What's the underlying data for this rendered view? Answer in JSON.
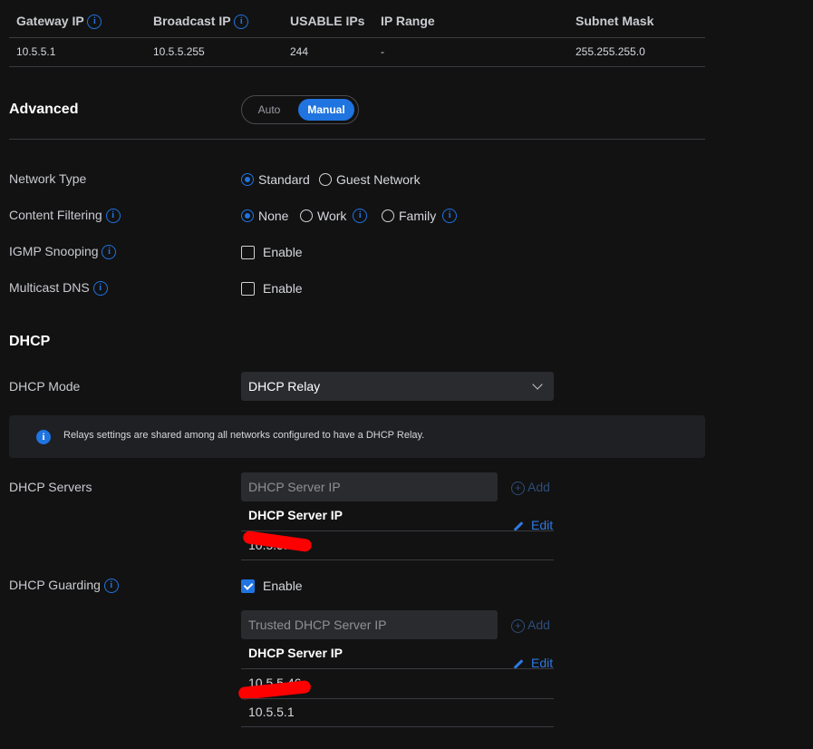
{
  "subnet_table": {
    "headers": [
      "Gateway IP",
      "Broadcast IP",
      "USABLE IPs",
      "IP Range",
      "Subnet Mask"
    ],
    "row": [
      "10.5.5.1",
      "10.5.5.255",
      "244",
      "-",
      "255.255.255.0"
    ]
  },
  "advanced": {
    "title": "Advanced",
    "mode_options": [
      "Auto",
      "Manual"
    ],
    "selected_mode": "Manual"
  },
  "network_type": {
    "label": "Network Type",
    "options": [
      "Standard",
      "Guest Network"
    ],
    "selected": "Standard"
  },
  "content_filtering": {
    "label": "Content Filtering",
    "options": [
      "None",
      "Work",
      "Family"
    ],
    "selected": "None"
  },
  "igmp_snooping": {
    "label": "IGMP Snooping",
    "option": "Enable",
    "checked": false
  },
  "multicast_dns": {
    "label": "Multicast DNS",
    "option": "Enable",
    "checked": false
  },
  "dhcp": {
    "title": "DHCP",
    "mode_label": "DHCP Mode",
    "mode_value": "DHCP Relay",
    "info_banner": "Relays settings are shared among all networks configured to have a DHCP Relay.",
    "servers": {
      "label": "DHCP Servers",
      "input_placeholder": "DHCP Server IP",
      "add_label": "Add",
      "list_header": "DHCP Server IP",
      "edit_label": "Edit",
      "entries": [
        "10.5.5.46"
      ]
    },
    "guarding": {
      "label": "DHCP Guarding",
      "option": "Enable",
      "checked": true,
      "input_placeholder": "Trusted DHCP Server IP",
      "add_label": "Add",
      "list_header": "DHCP Server IP",
      "edit_label": "Edit",
      "entries": [
        "10.5.5.46",
        "10.5.5.1"
      ]
    }
  },
  "colors": {
    "accent": "#1f74e0",
    "background": "#121213",
    "redaction": "#ff0000"
  }
}
